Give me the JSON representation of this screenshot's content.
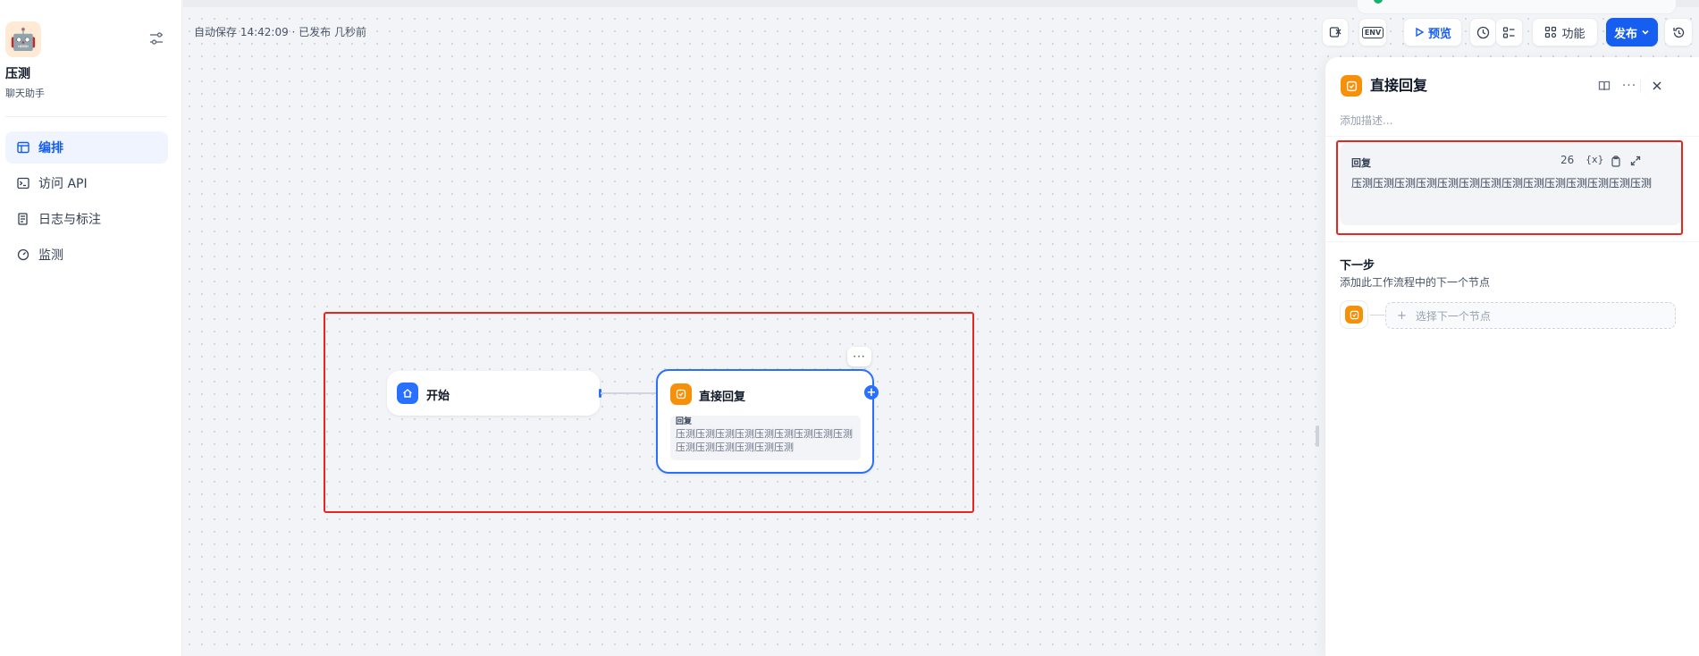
{
  "app": {
    "name": "压测",
    "type": "聊天助手",
    "avatar": "🤖"
  },
  "nav": [
    {
      "label": "编排",
      "icon": "layout-icon",
      "active": true
    },
    {
      "label": "访问 API",
      "icon": "terminal-icon",
      "active": false
    },
    {
      "label": "日志与标注",
      "icon": "file-list-icon",
      "active": false
    },
    {
      "label": "监测",
      "icon": "dashboard-icon",
      "active": false
    }
  ],
  "header": {
    "autosave": "自动保存 14:42:09 · 已发布 几秒前",
    "env_label": "ENV",
    "preview_label": "预览",
    "features_label": "功能",
    "publish_label": "发布"
  },
  "canvas": {
    "start_node": {
      "title": "开始"
    },
    "reply_node": {
      "title": "直接回复",
      "reply_label": "回复",
      "reply_text": "压测压测压测压测压测压测压测压测压测压测压测压测压测压测压测",
      "more": "···",
      "add": "+"
    }
  },
  "panel": {
    "title": "直接回复",
    "description_placeholder": "添加描述...",
    "reply_label": "回复",
    "char_count": "26",
    "vars_label": "{x}",
    "reply_text": "压测压测压测压测压测压测压测压测压测压测压测压测压测压测",
    "next_title": "下一步",
    "next_desc": "添加此工作流程中的下一个节点",
    "next_select": "选择下一个节点",
    "next_plus": "+"
  },
  "colors": {
    "primary": "#155eef",
    "reply_node": "#f79009",
    "highlight": "#e8261f"
  }
}
